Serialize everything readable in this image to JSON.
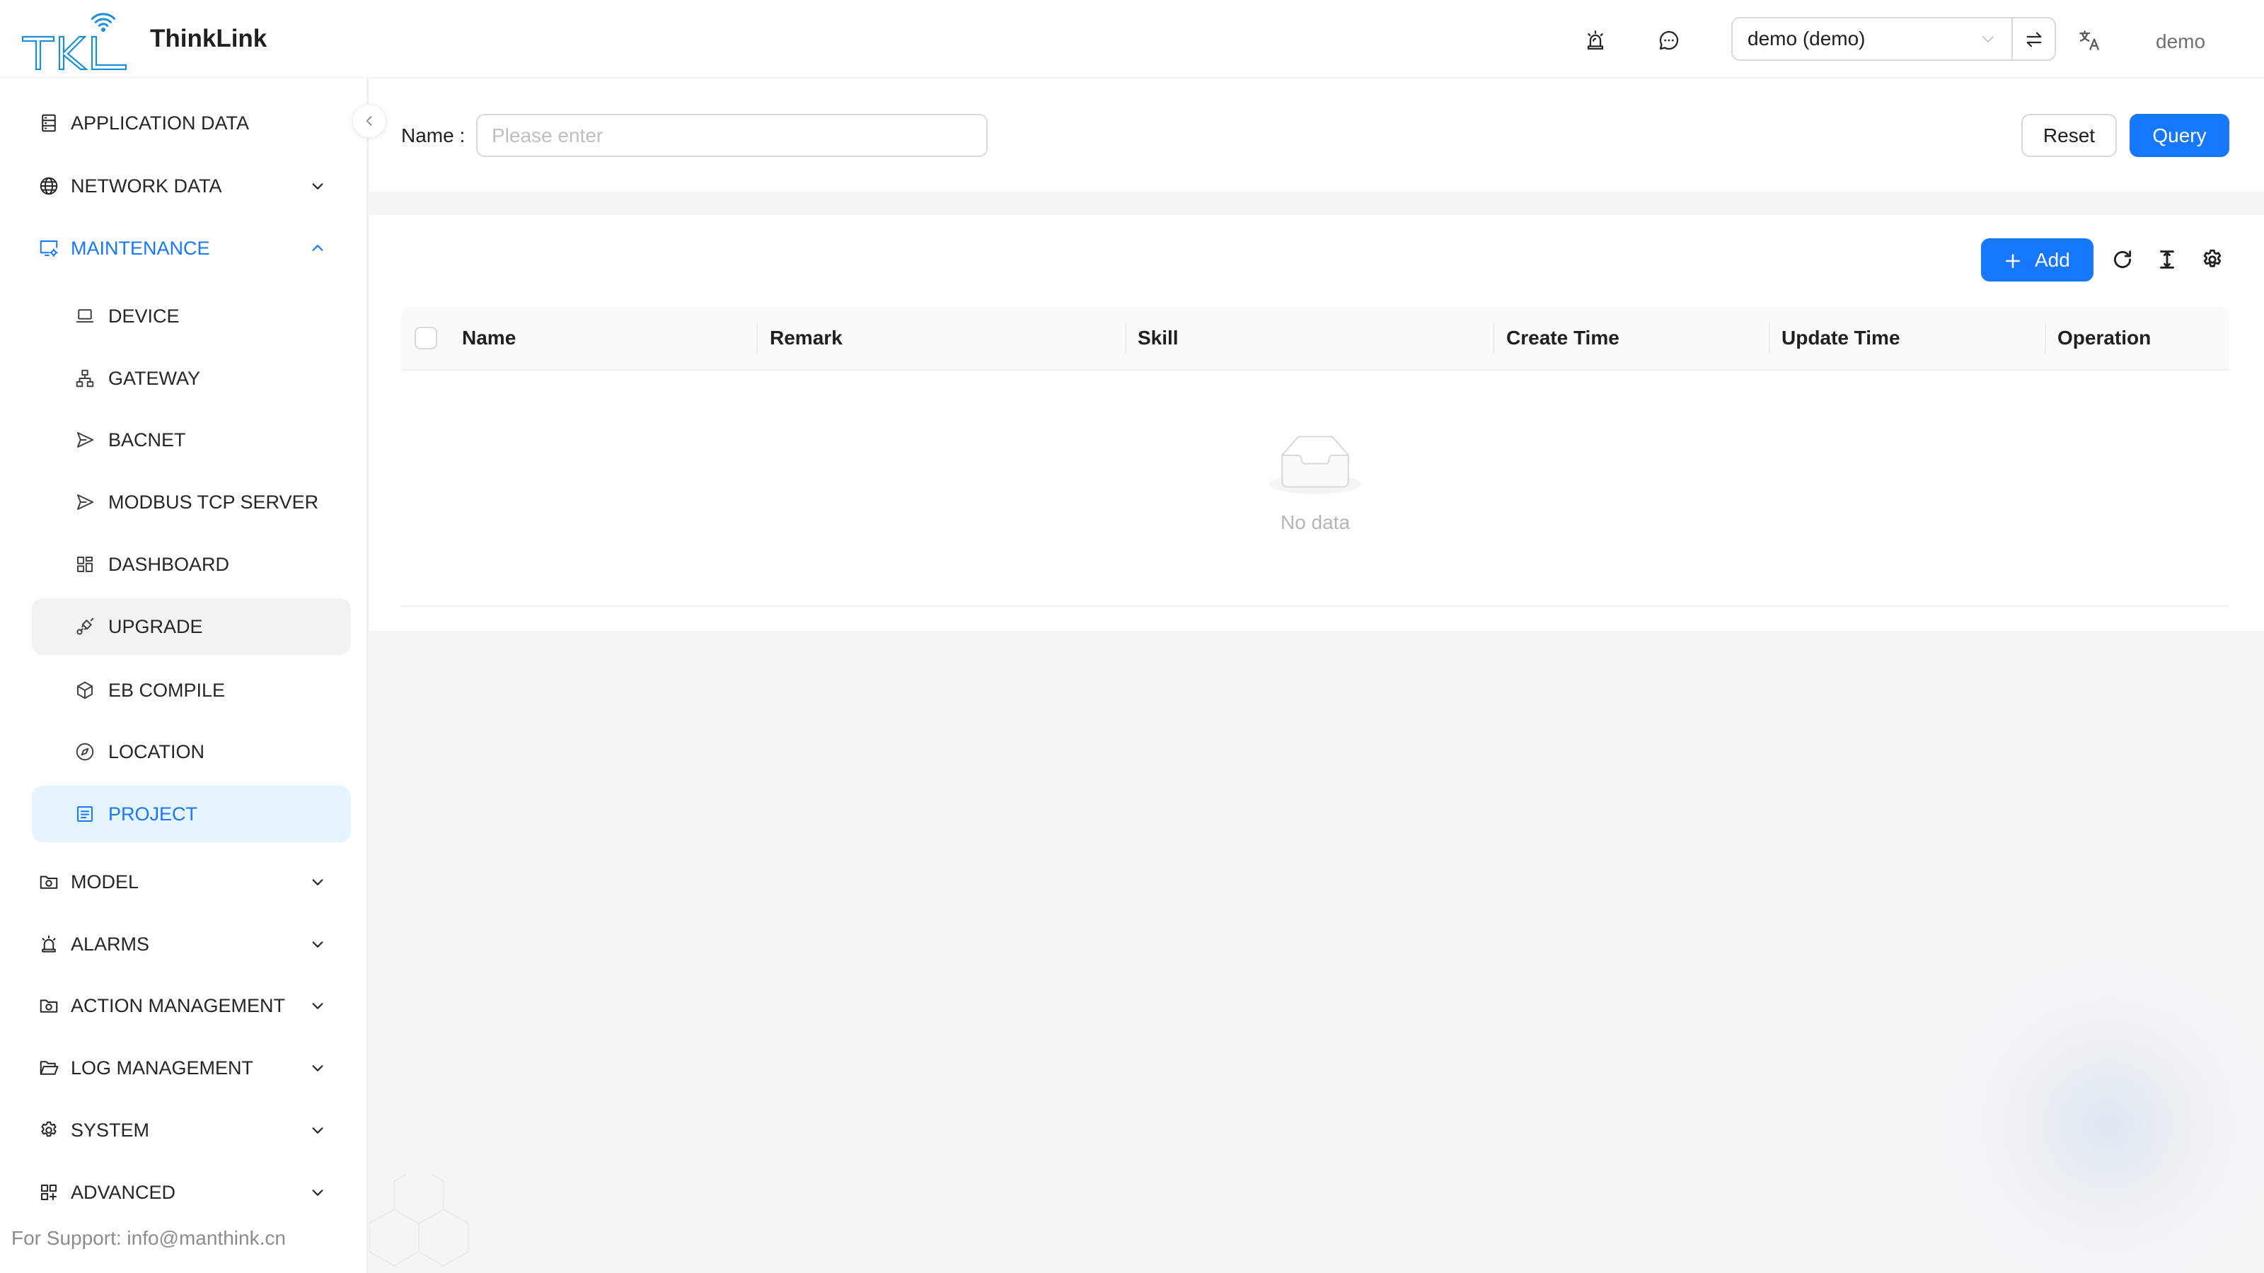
{
  "app": {
    "title": "ThinkLink",
    "logo_text": "TKL"
  },
  "header": {
    "alarm_icon": "alert-icon",
    "message_icon": "message-icon",
    "tenant_select": {
      "value": "demo (demo)",
      "arrow_icon": "chevron-down-icon"
    },
    "swap_icon": "swap-icon",
    "language_icon": "translate-icon",
    "user": "demo"
  },
  "sidebar": {
    "collapse_icon": "chevron-left-icon",
    "items": [
      {
        "label": "APPLICATION DATA",
        "icon": "database-icon",
        "level": 1
      },
      {
        "label": "NETWORK DATA",
        "icon": "global-icon",
        "level": 1,
        "expanded": false
      },
      {
        "label": "MAINTENANCE",
        "icon": "desktop-gear-icon",
        "level": 1,
        "expanded": true,
        "active": true
      },
      {
        "label": "DEVICE",
        "icon": "laptop-icon",
        "level": 2
      },
      {
        "label": "GATEWAY",
        "icon": "cluster-icon",
        "level": 2
      },
      {
        "label": "BACNET",
        "icon": "send-icon",
        "level": 2
      },
      {
        "label": "MODBUS TCP SERVER",
        "icon": "send-icon",
        "level": 2
      },
      {
        "label": "DASHBOARD",
        "icon": "dashboard-icon",
        "level": 2
      },
      {
        "label": "UPGRADE",
        "icon": "api-icon",
        "level": 2,
        "hovered": true
      },
      {
        "label": "EB COMPILE",
        "icon": "code-sandbox-icon",
        "level": 2
      },
      {
        "label": "LOCATION",
        "icon": "compass-icon",
        "level": 2
      },
      {
        "label": "PROJECT",
        "icon": "profile-icon",
        "level": 2,
        "selected": true
      },
      {
        "label": "MODEL",
        "icon": "camera-folder-icon",
        "level": 1,
        "expanded": false
      },
      {
        "label": "ALARMS",
        "icon": "alert-icon",
        "level": 1,
        "expanded": false
      },
      {
        "label": "ACTION MANAGEMENT",
        "icon": "camera-folder-icon",
        "level": 1,
        "expanded": false
      },
      {
        "label": "LOG MANAGEMENT",
        "icon": "folder-open-icon",
        "level": 1,
        "expanded": false
      },
      {
        "label": "SYSTEM",
        "icon": "setting-icon",
        "level": 1,
        "expanded": false
      },
      {
        "label": "ADVANCED",
        "icon": "appstore-add-icon",
        "level": 1,
        "expanded": false
      }
    ],
    "support_text": "For Support: info@manthink.cn"
  },
  "search": {
    "name_label": "Name :",
    "name_value": "",
    "name_placeholder": "Please enter",
    "reset_label": "Reset",
    "query_label": "Query"
  },
  "table": {
    "add_label": "Add",
    "add_icon": "plus-icon",
    "toolbar_icons": [
      "reload-icon",
      "column-height-icon",
      "setting-icon"
    ],
    "columns": [
      "Name",
      "Remark",
      "Skill",
      "Create Time",
      "Update Time",
      "Operation"
    ],
    "rows": [],
    "empty_text": "No data",
    "empty_icon": "inbox-empty-icon"
  },
  "colors": {
    "primary": "#1677ff",
    "selected_bg": "#e6f4ff",
    "hover_bg": "#f2f2f2",
    "page_bg": "#f5f5f5",
    "logo": "#1b8fd9"
  }
}
